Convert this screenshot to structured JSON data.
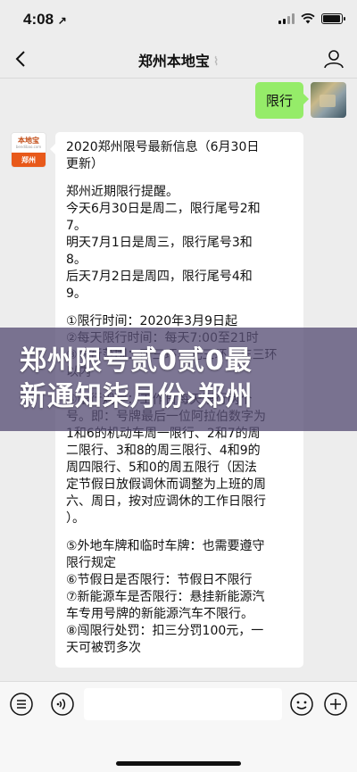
{
  "status_bar": {
    "time": "4:08",
    "location_arrow": "↗",
    "battery_level": 0.95
  },
  "nav": {
    "title": "郑州本地宝",
    "back_icon": "chevron-left",
    "profile_icon": "person"
  },
  "messages": {
    "me": {
      "text": "限行"
    },
    "other": {
      "paragraphs": [
        [
          "2020郑州限号最新信息（6月30日",
          "更新）"
        ],
        [
          "郑州近期限行提醒。",
          "今天6月30日是周二，限行尾号2和",
          "7。",
          "明天7月1日是周三，限行尾号3和",
          "8。",
          "后天7月2日是周四，限行尾号4和",
          "9。"
        ],
        [
          "①限行时间：2020年3月9日起",
          "②每天限行时间：每天7:00至21时",
          "③限行范围：西三环、北三环、东三环",
          "以内"
        ],
        [
          "④限行规定：工作日每天限行两个",
          "号。即：号牌最后一位阿拉伯数字为",
          "1和6的机动车周一限行、2和7的周",
          "二限行、3和8的周三限行、4和9的",
          "周四限行、5和0的周五限行（因法",
          "定节假日放假调休而调整为上班的周",
          "六、周日，按对应调休的工作日限行",
          "）。"
        ],
        [
          "⑤外地车牌和临时车牌：也需要遵守",
          "限行规定",
          "⑥节假日是否限行：节假日不限行",
          "⑦新能源车是否限行：悬挂新能源汽",
          "车专用号牌的新能源汽车不限行。",
          "⑧闯限行处罚：扣三分罚100元，一",
          "天可被罚多次"
        ]
      ]
    },
    "other_avatar": {
      "logo": "本地宝",
      "sub": "bendibao.com",
      "city": "郑州"
    }
  },
  "banner": {
    "line1": "郑州限号贰0贰0最",
    "line2": "新通知柒月份›郑州"
  },
  "input_bar": {
    "placeholder": "",
    "icons": [
      "menu-icon",
      "voice-icon",
      "emoji-icon",
      "plus-icon"
    ]
  }
}
